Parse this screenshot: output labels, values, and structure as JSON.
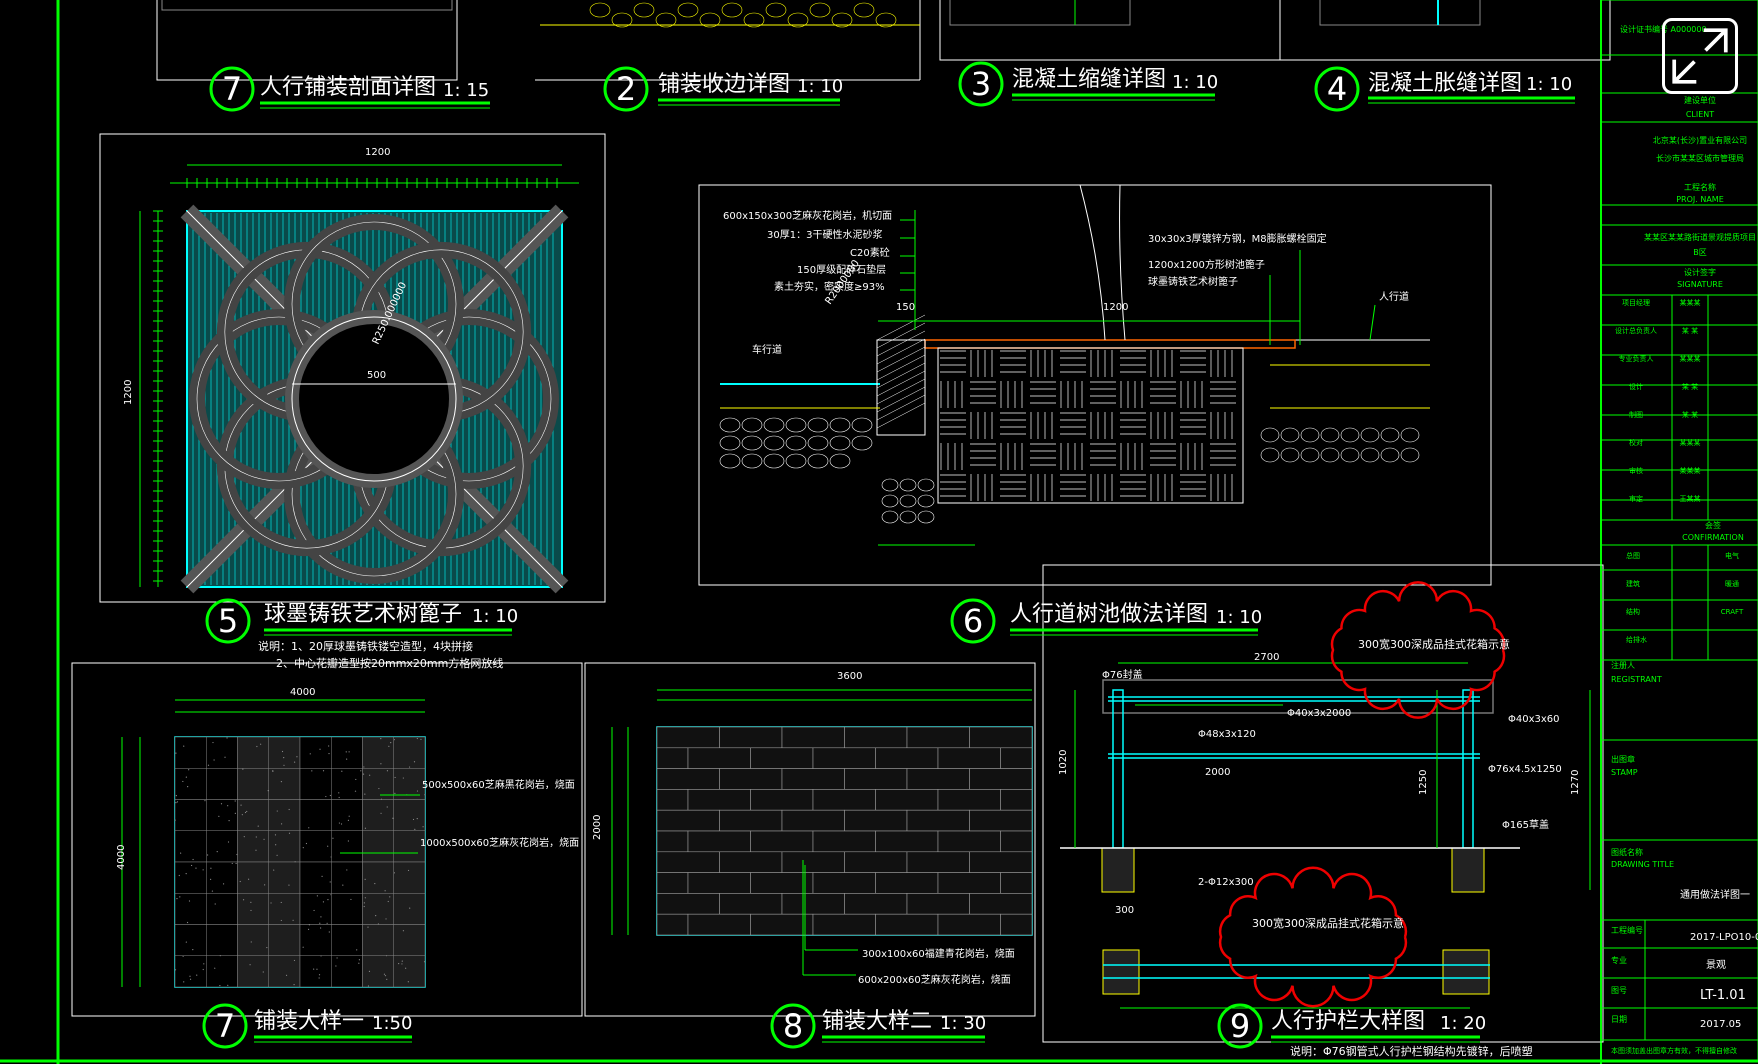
{
  "details": {
    "d1": {
      "num": "7",
      "title": "人行铺装剖面详图",
      "scale": "1: 15"
    },
    "d2": {
      "num": "2",
      "title": "铺装收边详图",
      "scale": "1: 10"
    },
    "d3": {
      "num": "3",
      "title": "混凝土缩缝详图",
      "scale": "1: 10"
    },
    "d4": {
      "num": "4",
      "title": "混凝土胀缝详图",
      "scale": "1: 10"
    },
    "d5": {
      "num": "5",
      "title": "球墨铸铁艺术树篦子",
      "scale": "1: 10",
      "note1": "说明：1、20厚球墨铸铁镂空造型，4块拼接",
      "note2": "2、中心花瓣造型按20mmx20mm方格网放线",
      "dim_top": "1200",
      "dim_left": "1200",
      "dim_r": "R250.000000",
      "dim_500": "500"
    },
    "d6": {
      "num": "6",
      "title": "人行道树池做法详图",
      "scale": "1: 10",
      "labels": [
        "600x150x300芝麻灰花岗岩，机切面",
        "30厚1：3干硬性水泥砂浆",
        "C20素砼",
        "150厚级配碎石垫层",
        "素土夯实，密实度≥93%"
      ],
      "label_right1": "30x30x3厚镀锌方钢，M8膨胀螺栓固定",
      "label_right2": "1200x1200方形树池篦子",
      "label_right3": "球墨铸铁艺术树篦子",
      "road": "车行道",
      "walk": "人行道",
      "dim1200": "1200",
      "dim150": "150",
      "r": "R2000000"
    },
    "d7": {
      "num": "7",
      "title": "铺装大样一",
      "scale": "1:50",
      "label1": "500x500x60芝麻黑花岗岩，烧面",
      "label2": "1000x500x60芝麻灰花岗岩，烧面",
      "dim_top": "4000",
      "dim_left": "4000"
    },
    "d8": {
      "num": "8",
      "title": "铺装大样二",
      "scale": "1: 30",
      "label1": "300x100x60福建青花岗岩，烧面",
      "label2": "600x200x60芝麻灰花岗岩，烧面",
      "dim_top": "3600",
      "dim_left": "2000"
    },
    "d9": {
      "num": "9",
      "title": "人行护栏大样图",
      "scale": "1: 20",
      "cloud1": "300宽300深成品挂式花箱示意",
      "cloud2": "300宽300深成品挂式花箱示意",
      "note": "说明：Φ76钢管式人行护栏钢结构先镀锌，后喷塑",
      "labels": [
        "Φ76封盖",
        "Φ40x3x2000",
        "Φ48x3x120",
        "2000",
        "Φ40x3x60",
        "Φ76x4.5x1250",
        "Φ165草盖",
        "2-Φ12x300",
        "2700",
        "1020",
        "1250",
        "1270",
        "300"
      ]
    }
  },
  "title_block": {
    "client_cn": "建设单位",
    "client_en": "CLIENT",
    "client_name1": "北京某(长沙)置业有限公司",
    "client_name2": "长沙市某某区城市管理局",
    "proj_cn": "工程名称",
    "proj_en": "PROJ. NAME",
    "proj_name": "某某区某某路街道景观提质项目",
    "proj_sub": "B区",
    "sig_cn": "设计签字",
    "sig_en": "SIGNATURE",
    "roles": [
      "项目经理",
      "设计总负责人",
      "专业负责人",
      "设计",
      "制图",
      "校对",
      "审核",
      "审定"
    ],
    "names": [
      "某某某",
      "某 某",
      "某某某",
      "某 某",
      "某 某",
      "某某某",
      "某某某",
      "王某某"
    ],
    "confirm_cn": "会签",
    "confirm_en": "CONFIRMATION",
    "confirm_rows": [
      "总图",
      "建筑",
      "结构",
      "给排水"
    ],
    "confirm_right": [
      "电气",
      "暖通",
      "CRAFT"
    ],
    "registrant_cn": "注册人",
    "registrant_en": "REGISTRANT",
    "stamp_cn": "出图章",
    "stamp_en": "STAMP",
    "dtitle_cn": "图纸名称",
    "dtitle_en": "DRAWING TITLE",
    "dtitle": "通用做法详图一",
    "proj_no_label": "工程编号",
    "proj_no": "2017-LPO10-02",
    "major_label": "专业",
    "major": "景观",
    "draw_no_label": "图号",
    "draw_no": "LT-1.01",
    "date_label": "日期",
    "date": "2017.05",
    "top_code": "设计证书编号 A000000",
    "footer": "本图须加盖出图章方有效，不得擅自修改"
  },
  "ui": {
    "expand": "expand-icon"
  }
}
